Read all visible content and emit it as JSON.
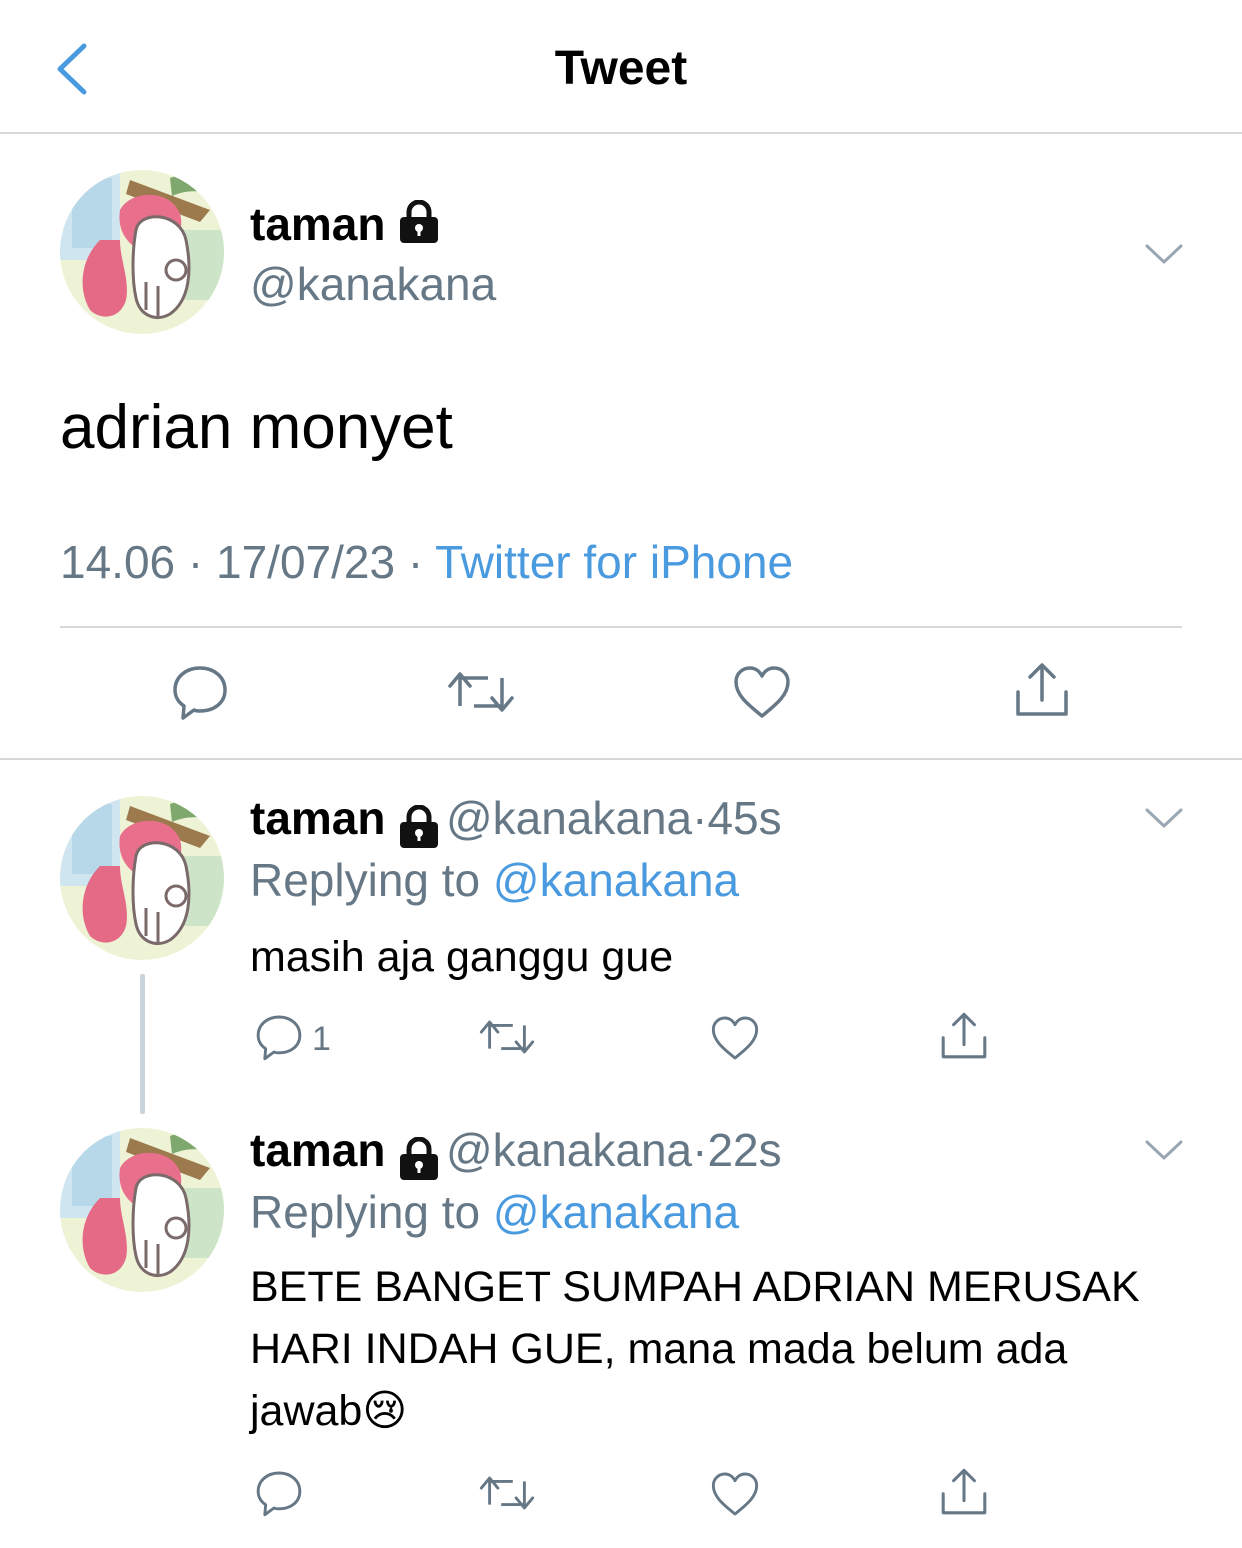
{
  "header": {
    "title": "Tweet"
  },
  "main_tweet": {
    "name": "taman",
    "handle": "@kanakana",
    "text": "adrian monyet",
    "time": "14.06",
    "date": "17/07/23",
    "separator": "·",
    "source": "Twitter for iPhone"
  },
  "replies": [
    {
      "name": "taman",
      "handle": "@kanakana",
      "separator": "·",
      "time": "45s",
      "replying_label": "Replying to",
      "replying_handle": "@kanakana",
      "text": "masih aja ganggu gue",
      "reply_count": "1"
    },
    {
      "name": "taman",
      "handle": "@kanakana",
      "separator": "·",
      "time": "22s",
      "replying_label": "Replying to",
      "replying_handle": "@kanakana",
      "text": "BETE BANGET SUMPAH ADRIAN MERUSAK HARI INDAH GUE, mana mada belum ada jawab😢",
      "reply_count": ""
    }
  ],
  "icons": {
    "back": "chevron-left-icon",
    "lock": "lock-icon",
    "more": "chevron-down-icon",
    "reply": "comment-icon",
    "retweet": "retweet-icon",
    "like": "heart-icon",
    "share": "share-icon"
  },
  "colors": {
    "accent": "#4a9ae0",
    "secondary_text": "#667786",
    "divider": "#d6d9dc"
  }
}
